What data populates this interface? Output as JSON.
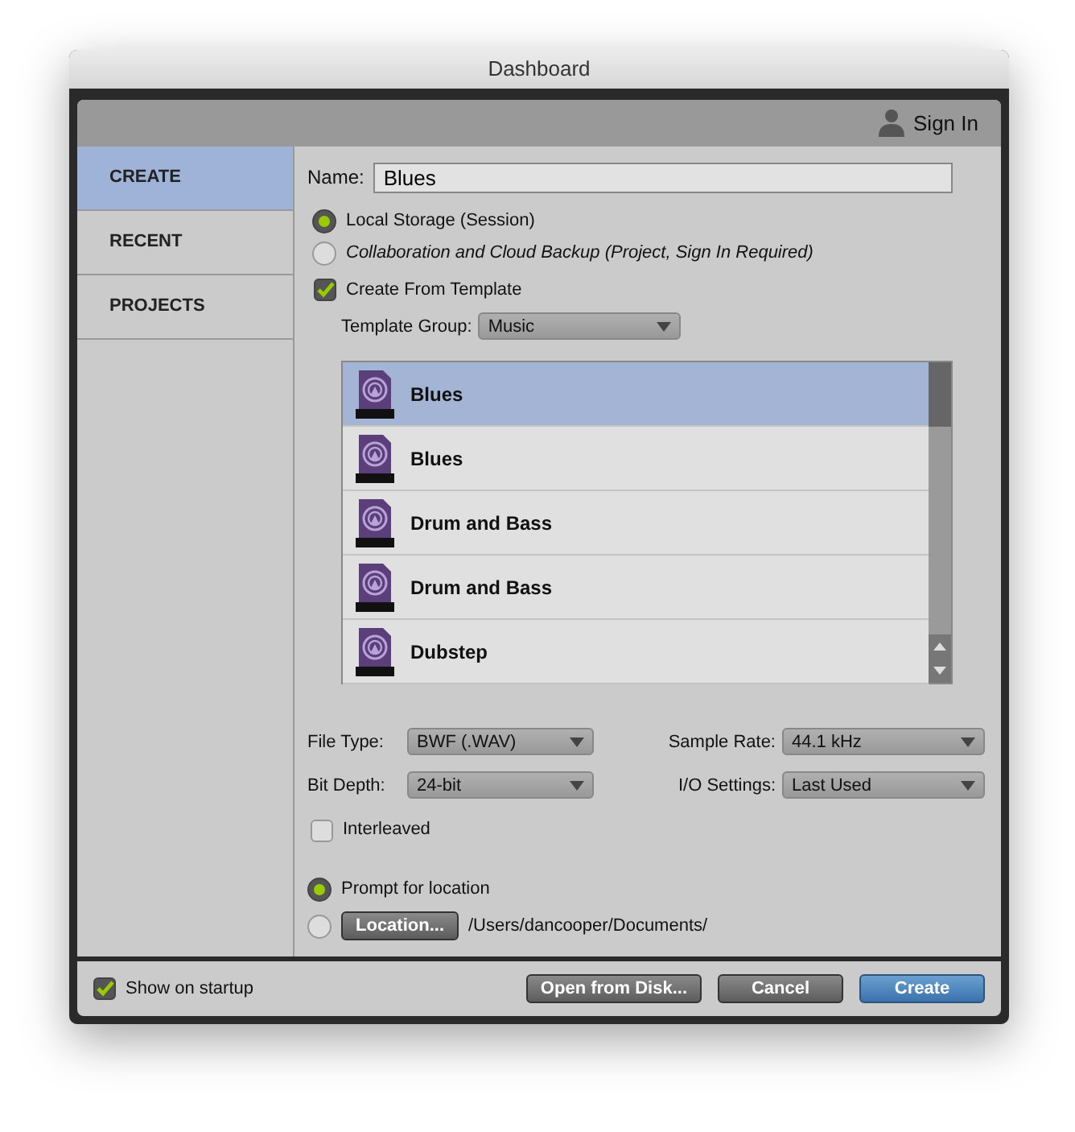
{
  "window": {
    "title": "Dashboard"
  },
  "header": {
    "sign_in": "Sign In"
  },
  "sidebar": {
    "items": [
      {
        "label": "CREATE",
        "selected": true
      },
      {
        "label": "RECENT",
        "selected": false
      },
      {
        "label": "PROJECTS",
        "selected": false
      }
    ]
  },
  "name_field": {
    "label": "Name:",
    "value": "Blues"
  },
  "storage_options": [
    {
      "label": "Local Storage (Session)",
      "selected": true,
      "italic": false
    },
    {
      "label": "Collaboration and Cloud Backup (Project, Sign In Required)",
      "selected": false,
      "italic": true
    }
  ],
  "create_from_template": {
    "label": "Create From Template",
    "checked": true
  },
  "template_group": {
    "label": "Template Group:",
    "value": "Music"
  },
  "templates": [
    {
      "name": "Blues",
      "selected": true
    },
    {
      "name": "Blues",
      "selected": false
    },
    {
      "name": "Drum and Bass",
      "selected": false
    },
    {
      "name": "Drum and Bass",
      "selected": false
    },
    {
      "name": "Dubstep",
      "selected": false
    }
  ],
  "settings": [
    {
      "label": "File Type:",
      "value": "BWF (.WAV)"
    },
    {
      "label": "Sample Rate:",
      "value": "44.1 kHz"
    },
    {
      "label": "Bit Depth:",
      "value": "24-bit"
    },
    {
      "label": "I/O Settings:",
      "value": "Last Used"
    }
  ],
  "interleaved": {
    "label": "Interleaved",
    "checked": false
  },
  "location_options": [
    {
      "kind": "text",
      "label": "Prompt for location",
      "selected": true
    },
    {
      "kind": "button",
      "button": "Location...",
      "path": "/Users/dancooper/Documents/",
      "selected": false
    }
  ],
  "footer": {
    "show_on_startup": {
      "label": "Show on startup",
      "checked": true
    },
    "buttons": [
      {
        "label": "Open from Disk...",
        "kind": "default"
      },
      {
        "label": "Cancel",
        "kind": "default"
      },
      {
        "label": "Create",
        "kind": "primary"
      }
    ]
  }
}
